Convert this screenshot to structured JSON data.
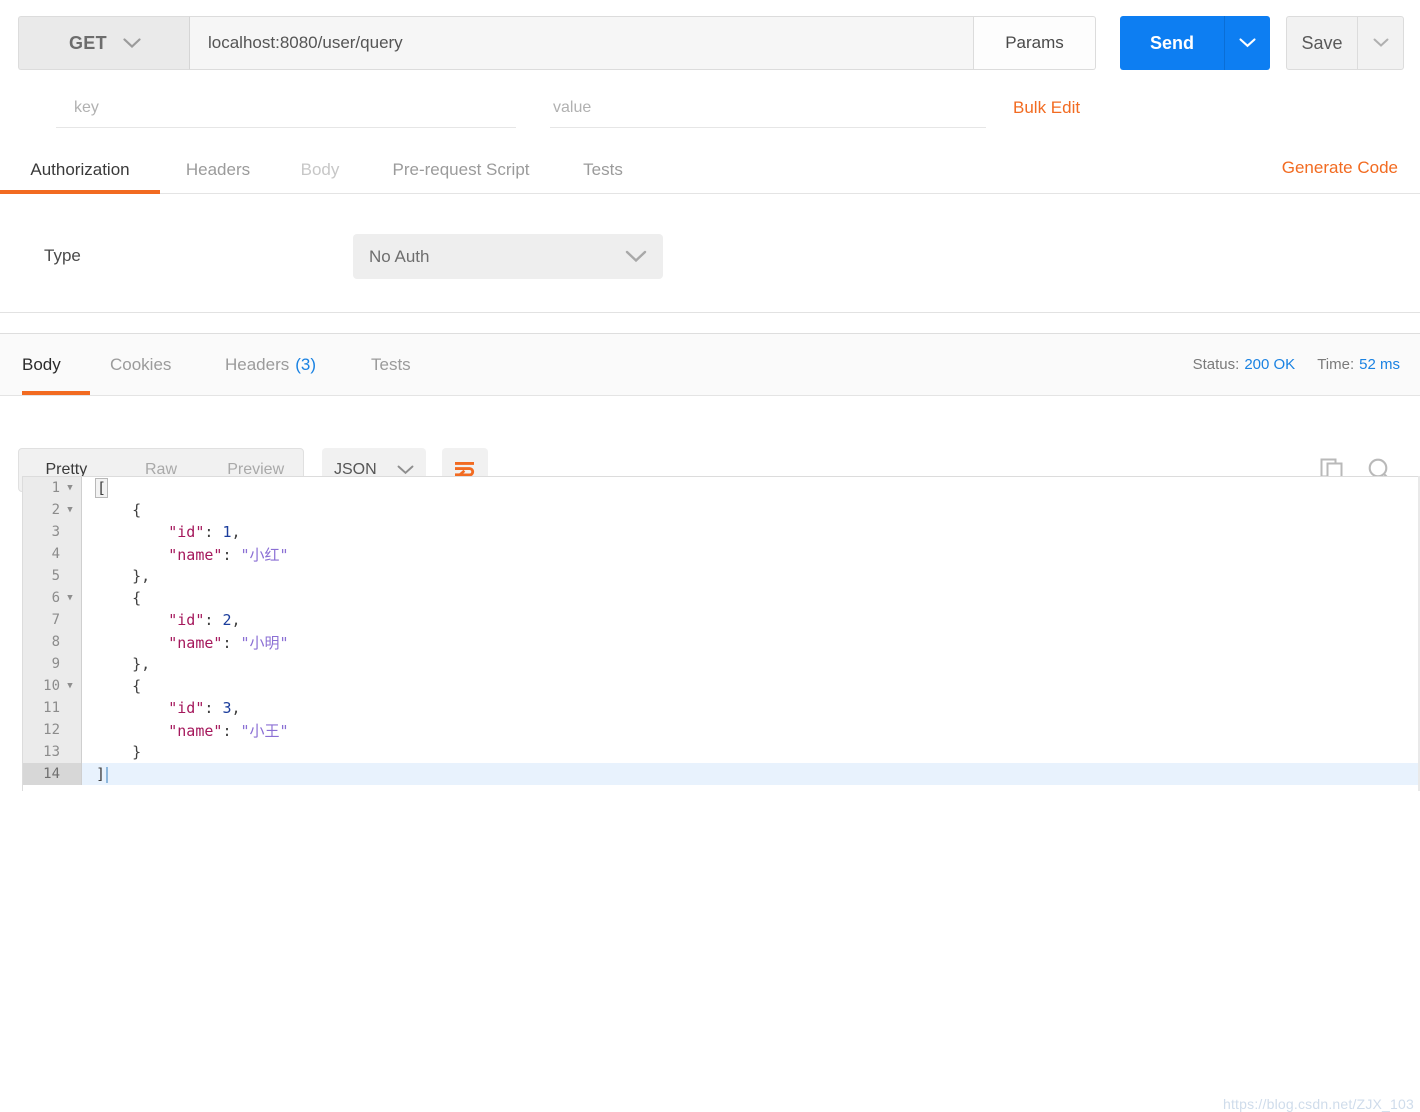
{
  "request": {
    "method": "GET",
    "url": "localhost:8080/user/query",
    "params_label": "Params",
    "send_label": "Send",
    "save_label": "Save",
    "key_placeholder": "key",
    "value_placeholder": "value",
    "bulk_edit_label": "Bulk Edit",
    "generate_code_label": "Generate Code",
    "tabs": [
      {
        "label": "Authorization",
        "state": "active"
      },
      {
        "label": "Headers",
        "state": "inactive"
      },
      {
        "label": "Body",
        "state": "disabled"
      },
      {
        "label": "Pre-request Script",
        "state": "inactive"
      },
      {
        "label": "Tests",
        "state": "inactive"
      }
    ],
    "auth": {
      "type_label": "Type",
      "type_value": "No Auth"
    }
  },
  "response": {
    "tabs": [
      {
        "label": "Body",
        "state": "active",
        "count": ""
      },
      {
        "label": "Cookies",
        "state": "inactive",
        "count": ""
      },
      {
        "label": "Headers",
        "state": "inactive",
        "count": "(3)"
      },
      {
        "label": "Tests",
        "state": "inactive",
        "count": ""
      }
    ],
    "status_label": "Status:",
    "status_value": "200 OK",
    "time_label": "Time:",
    "time_value": "52 ms",
    "view_modes": [
      {
        "label": "Pretty",
        "state": "active"
      },
      {
        "label": "Raw",
        "state": "inactive"
      },
      {
        "label": "Preview",
        "state": "inactive"
      }
    ],
    "format": "JSON",
    "body_lines": [
      {
        "n": "1",
        "fold": true,
        "indent": 0,
        "tokens": [
          {
            "t": "bracket",
            "v": "["
          }
        ]
      },
      {
        "n": "2",
        "fold": true,
        "indent": 1,
        "tokens": [
          {
            "t": "punc",
            "v": "{"
          }
        ]
      },
      {
        "n": "3",
        "fold": false,
        "indent": 2,
        "tokens": [
          {
            "t": "key",
            "v": "\"id\""
          },
          {
            "t": "punc",
            "v": ": "
          },
          {
            "t": "num",
            "v": "1"
          },
          {
            "t": "punc",
            "v": ","
          }
        ]
      },
      {
        "n": "4",
        "fold": false,
        "indent": 2,
        "tokens": [
          {
            "t": "key",
            "v": "\"name\""
          },
          {
            "t": "punc",
            "v": ": "
          },
          {
            "t": "str",
            "v": "\"小红\""
          }
        ]
      },
      {
        "n": "5",
        "fold": false,
        "indent": 1,
        "tokens": [
          {
            "t": "punc",
            "v": "},"
          }
        ]
      },
      {
        "n": "6",
        "fold": true,
        "indent": 1,
        "tokens": [
          {
            "t": "punc",
            "v": "{"
          }
        ]
      },
      {
        "n": "7",
        "fold": false,
        "indent": 2,
        "tokens": [
          {
            "t": "key",
            "v": "\"id\""
          },
          {
            "t": "punc",
            "v": ": "
          },
          {
            "t": "num",
            "v": "2"
          },
          {
            "t": "punc",
            "v": ","
          }
        ]
      },
      {
        "n": "8",
        "fold": false,
        "indent": 2,
        "tokens": [
          {
            "t": "key",
            "v": "\"name\""
          },
          {
            "t": "punc",
            "v": ": "
          },
          {
            "t": "str",
            "v": "\"小明\""
          }
        ]
      },
      {
        "n": "9",
        "fold": false,
        "indent": 1,
        "tokens": [
          {
            "t": "punc",
            "v": "},"
          }
        ]
      },
      {
        "n": "10",
        "fold": true,
        "indent": 1,
        "tokens": [
          {
            "t": "punc",
            "v": "{"
          }
        ]
      },
      {
        "n": "11",
        "fold": false,
        "indent": 2,
        "tokens": [
          {
            "t": "key",
            "v": "\"id\""
          },
          {
            "t": "punc",
            "v": ": "
          },
          {
            "t": "num",
            "v": "3"
          },
          {
            "t": "punc",
            "v": ","
          }
        ]
      },
      {
        "n": "12",
        "fold": false,
        "indent": 2,
        "tokens": [
          {
            "t": "key",
            "v": "\"name\""
          },
          {
            "t": "punc",
            "v": ": "
          },
          {
            "t": "str",
            "v": "\"小王\""
          }
        ]
      },
      {
        "n": "13",
        "fold": false,
        "indent": 1,
        "tokens": [
          {
            "t": "punc",
            "v": "}"
          }
        ]
      },
      {
        "n": "14",
        "fold": false,
        "indent": 0,
        "current": true,
        "caret": true,
        "tokens": [
          {
            "t": "punc",
            "v": "]"
          }
        ]
      }
    ]
  },
  "watermark": "https://blog.csdn.net/ZJX_103",
  "colors": {
    "accent_orange": "#f26b21",
    "accent_blue": "#0d7ef2",
    "link_blue": "#1a82e2",
    "json_key": "#a5185c",
    "json_number": "#1b3d9c",
    "json_string": "#8b6fd4",
    "current_line": "#e8f2fd"
  }
}
